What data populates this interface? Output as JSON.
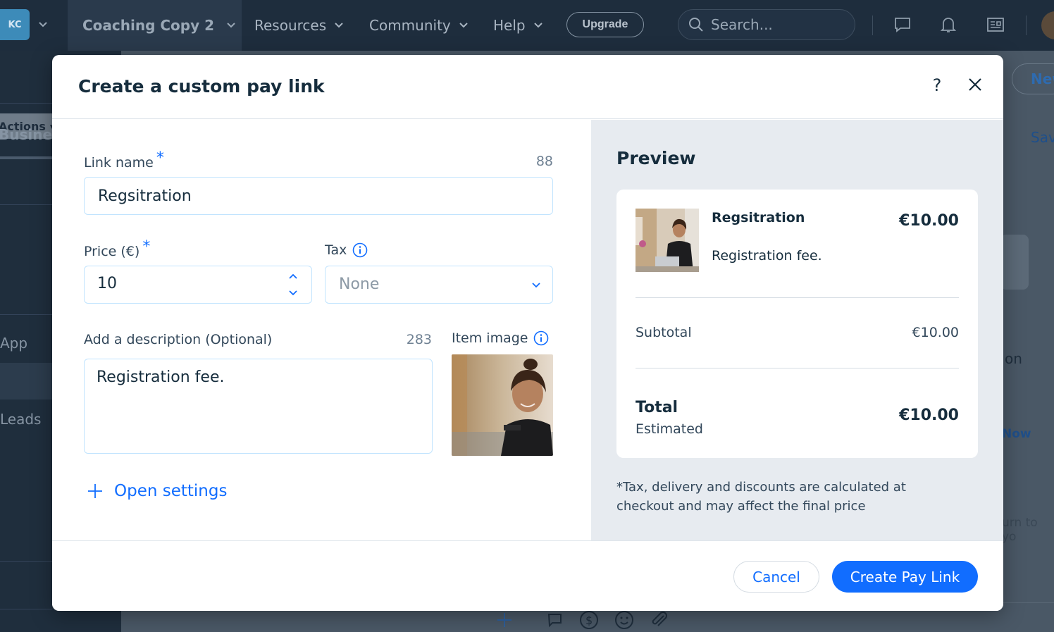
{
  "topbar": {
    "logo": "KC",
    "site_name": "Coaching Copy 2",
    "nav": [
      "Resources",
      "Community",
      "Help"
    ],
    "upgrade": "Upgrade",
    "search_placeholder": "Search..."
  },
  "background": {
    "actions": "Actions",
    "business": "Business",
    "app": "App",
    "leads": "Leads",
    "new_button": "New",
    "save": "Save",
    "on_text": "on",
    "now_text": "Now",
    "return_text": "urn to yo"
  },
  "modal": {
    "title": "Create a custom pay link",
    "help": "?",
    "form": {
      "link_name_label": "Link name",
      "required_mark": "*",
      "link_name_counter": "88",
      "link_name_value": "Regsitration",
      "price_label": "Price (€)",
      "price_value": "10",
      "tax_label": "Tax",
      "tax_value": "None",
      "description_label": "Add a description (Optional)",
      "description_counter": "283",
      "description_value": "Registration fee.",
      "item_image_label": "Item image",
      "open_settings": "Open settings"
    },
    "preview": {
      "title": "Preview",
      "item_name": "Regsitration",
      "item_price": "€10.00",
      "item_description": "Registration fee.",
      "subtotal_label": "Subtotal",
      "subtotal_value": "€10.00",
      "total_label": "Total",
      "estimated_label": "Estimated",
      "total_value": "€10.00",
      "note": "*Tax, delivery and discounts are calculated at checkout and may affect the final price"
    },
    "footer": {
      "cancel": "Cancel",
      "create": "Create Pay Link"
    }
  },
  "colors": {
    "accent": "#116dff",
    "topbar": "#1e2d3d",
    "preview_bg": "#e7ebf0"
  }
}
